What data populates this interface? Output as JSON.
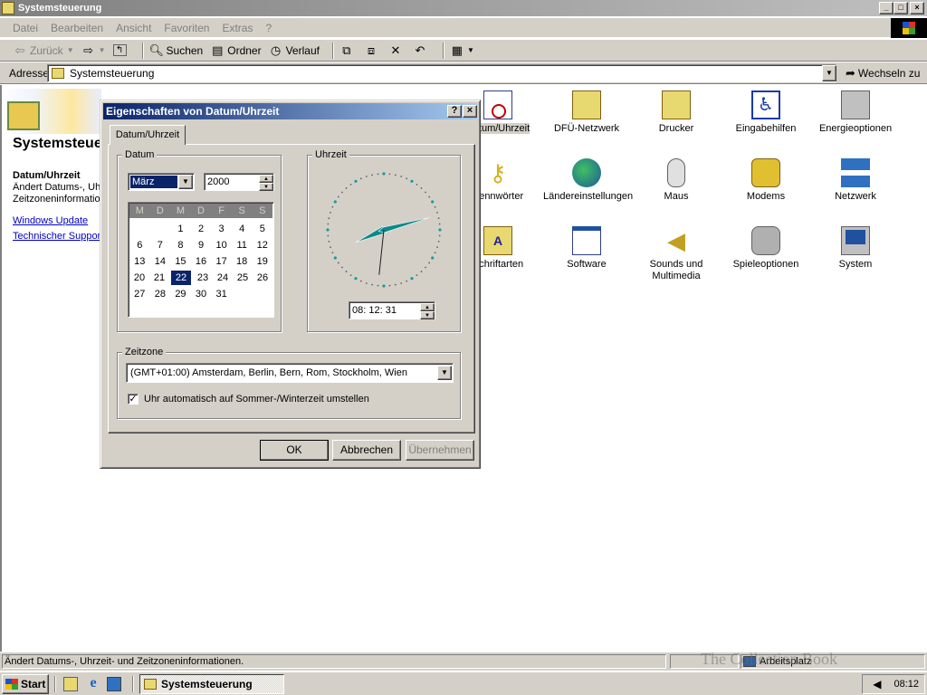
{
  "window": {
    "title": "Systemsteuerung",
    "caption_buttons": [
      "_",
      "□",
      "×"
    ]
  },
  "menu": {
    "items": [
      "Datei",
      "Bearbeiten",
      "Ansicht",
      "Favoriten",
      "Extras",
      "?"
    ]
  },
  "toolbar": {
    "back": "Zurück",
    "search": "Suchen",
    "folders": "Ordner",
    "history": "Verlauf"
  },
  "address": {
    "label": "Adresse",
    "value": "Systemsteuerung",
    "go": "Wechseln zu"
  },
  "leftpane": {
    "title": "Systemsteuerung",
    "info_title": "Datum/Uhrzeit",
    "info_lines": [
      "Ändert Datums-, Uhrzeit-",
      "Zeitzoneninformationen."
    ],
    "links": [
      "Windows Update",
      "Technischer Support"
    ]
  },
  "icons": [
    {
      "label": "Datum/Uhrzeit",
      "icon": "clock-calendar-icon",
      "color": "#ffffff"
    },
    {
      "label": "DFÜ-Netzwerk",
      "icon": "dialup-network-icon",
      "color": "#e8d870"
    },
    {
      "label": "Drucker",
      "icon": "printer-folder-icon",
      "color": "#e8d870"
    },
    {
      "label": "Eingabehilfen",
      "icon": "accessibility-icon",
      "color": "#1a3aa8"
    },
    {
      "label": "Energieoptionen",
      "icon": "power-plug-icon",
      "color": "#c0c0c0"
    },
    {
      "label": "Kennwörter",
      "icon": "keys-icon",
      "color": "#d8b020"
    },
    {
      "label": "Ländereinstellungen",
      "icon": "globe-icon",
      "color": "#2a8a3a"
    },
    {
      "label": "Maus",
      "icon": "mouse-icon",
      "color": "#d8d8d8"
    },
    {
      "label": "Modems",
      "icon": "modem-phone-icon",
      "color": "#e0c030"
    },
    {
      "label": "Netzwerk",
      "icon": "network-computers-icon",
      "color": "#3070c0"
    },
    {
      "label": "Schriftarten",
      "icon": "fonts-folder-icon",
      "color": "#e8d870"
    },
    {
      "label": "Software",
      "icon": "software-window-icon",
      "color": "#5080c0"
    },
    {
      "label": "Sounds und Multimedia",
      "icon": "speaker-icon",
      "color": "#e0c040"
    },
    {
      "label": "Spieleoptionen",
      "icon": "joystick-icon",
      "color": "#a0a0a0"
    },
    {
      "label": "System",
      "icon": "computer-icon",
      "color": "#3060a0"
    }
  ],
  "dialog": {
    "title": "Eigenschaften von Datum/Uhrzeit",
    "help": "?",
    "close": "×",
    "tab": "Datum/Uhrzeit",
    "date_group": "Datum",
    "month": "März",
    "year": "2000",
    "weekdays": [
      "M",
      "D",
      "M",
      "D",
      "F",
      "S",
      "S"
    ],
    "weeks": [
      [
        "",
        "",
        "1",
        "2",
        "3",
        "4",
        "5"
      ],
      [
        "6",
        "7",
        "8",
        "9",
        "10",
        "11",
        "12"
      ],
      [
        "13",
        "14",
        "15",
        "16",
        "17",
        "18",
        "19"
      ],
      [
        "20",
        "21",
        "22",
        "23",
        "24",
        "25",
        "26"
      ],
      [
        "27",
        "28",
        "29",
        "30",
        "31",
        "",
        ""
      ]
    ],
    "selected_day": "22",
    "time_group": "Uhrzeit",
    "time": "08: 12: 31",
    "clock": {
      "hour": 8,
      "minute": 12,
      "second": 31
    },
    "timezone_group": "Zeitzone",
    "timezone": "(GMT+01:00) Amsterdam, Berlin, Bern, Rom, Stockholm, Wien",
    "dst_checked": "✓",
    "dst_label": "Uhr automatisch auf Sommer-/Winterzeit umstellen",
    "ok": "OK",
    "cancel": "Abbrechen",
    "apply": "Übernehmen"
  },
  "statusbar": {
    "text": "Ändert Datums-, Uhrzeit- und Zeitzoneninformationen.",
    "zone": "Arbeitsplatz"
  },
  "taskbar": {
    "start": "Start",
    "task": "Systemsteuerung",
    "clock": "08:12"
  },
  "watermark": "The Collection Book",
  "colors": {
    "title_active": "#0a246a",
    "title_inactive": "#808080",
    "face": "#d4d0c8",
    "clock_dots": "#0aa0a0"
  }
}
